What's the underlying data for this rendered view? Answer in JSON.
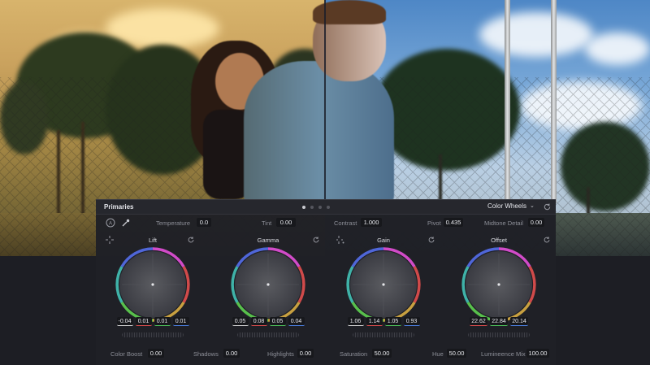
{
  "panel": {
    "title": "Primaries",
    "mode": "Color Wheels",
    "page_count": 4,
    "active_page": 1
  },
  "top_controls": {
    "temperature": {
      "label": "Temperature",
      "value": "0.0"
    },
    "tint": {
      "label": "Tint",
      "value": "0.00"
    },
    "contrast": {
      "label": "Contrast",
      "value": "1.000"
    },
    "pivot": {
      "label": "Pivot",
      "value": "0.435"
    },
    "midtone_detail": {
      "label": "Midtone Detail",
      "value": "0.00"
    }
  },
  "wheels": [
    {
      "name": "Lift",
      "values": [
        "-0.04",
        "0.01",
        "0.01",
        "0.01"
      ]
    },
    {
      "name": "Gamma",
      "values": [
        "0.05",
        "0.08",
        "0.05",
        "0.04"
      ]
    },
    {
      "name": "Gain",
      "values": [
        "1.06",
        "1.14",
        "1.05",
        "0.93"
      ]
    },
    {
      "name": "Offset",
      "values": [
        "22.62",
        "22.84",
        "20.14"
      ]
    }
  ],
  "bottom_controls": {
    "color_boost": {
      "label": "Color Boost",
      "value": "0.00"
    },
    "shadows": {
      "label": "Shadows",
      "value": "0.00"
    },
    "highlights": {
      "label": "Highlights",
      "value": "0.00"
    },
    "saturation": {
      "label": "Saturation",
      "value": "50.00"
    },
    "hue": {
      "label": "Hue",
      "value": "50.00"
    },
    "luminance_mix": {
      "label": "Lumineence Mix",
      "value": "100.00"
    }
  },
  "icons": {
    "header": [
      "chevron-down-icon",
      "reset-icon"
    ],
    "tools": [
      "auto-balance-icon",
      "picker-icon"
    ],
    "wheels": [
      "crosshair-icon",
      "reset-icon"
    ]
  },
  "colors": {
    "panel_bg": "#1f2026",
    "accent_red": "#d94c4c",
    "accent_green": "#4cc05a",
    "accent_blue": "#4c7fe0"
  }
}
